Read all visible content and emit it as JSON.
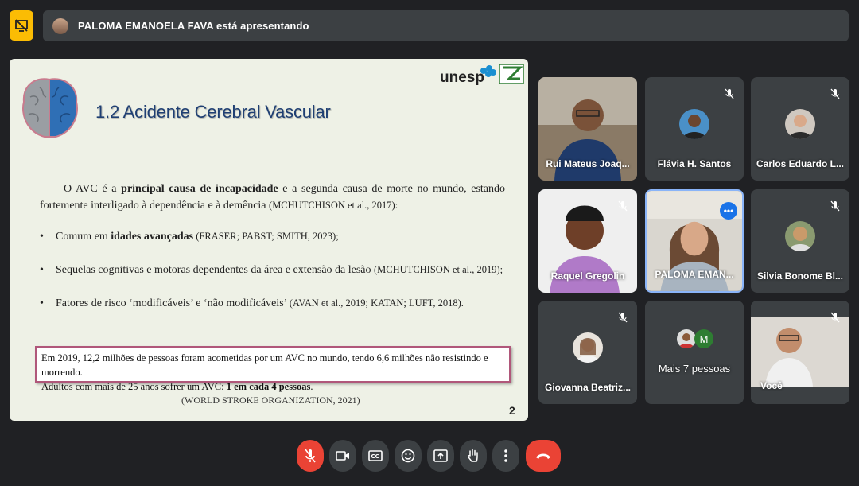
{
  "presenter_bar": {
    "text": "PALOMA EMANOELA FAVA está apresentando"
  },
  "slide": {
    "logo": "unesp",
    "title": "1.2 Acidente Cerebral Vascular",
    "paragraph_intro": "O AVC é a ",
    "paragraph_bold": "principal causa de incapacidade",
    "paragraph_rest": " e a segunda causa de morte no mundo, estando fortemente interligado à dependência e à demência ",
    "paragraph_cite": "(MCHUTCHISON et al., 2017):",
    "bullet1_text": "Comum em ",
    "bullet1_bold": "idades avançadas",
    "bullet1_cite": " (FRASER; PABST; SMITH, 2023);",
    "bullet2_text": "Sequelas cognitivas e motoras dependentes da área e extensão da lesão ",
    "bullet2_cite": "(MCHUTCHISON et al., 2019);",
    "bullet3_text": "Fatores de risco ‘modificáveis’ e ‘não modificáveis’ ",
    "bullet3_cite": "(AVAN et al., 2019; KATAN; LUFT, 2018).",
    "box_line1": "Em 2019, 12,2 milhões de pessoas foram acometidas por um AVC no mundo, tendo 6,6 milhões não resistindo e morrendo.",
    "box_line2_text": "Adultos com mais de 25 anos sofrer um AVC: ",
    "box_line2_bold": "1 em cada 4 pessoas",
    "box_line2_end": ".",
    "source": "(WORLD STROKE ORGANIZATION, 2021)",
    "page_number": "2"
  },
  "participants": [
    {
      "name": "Rui Mateus Joaq..."
    },
    {
      "name": "Flávia H. Santos"
    },
    {
      "name": "Carlos Eduardo L..."
    },
    {
      "name": "Raquel Gregolin"
    },
    {
      "name": "PALOMA EMAN..."
    },
    {
      "name": "Silvia Bonome Bl..."
    },
    {
      "name": "Giovanna Beatriz..."
    },
    {
      "name": "Mais 7 pessoas",
      "badge": "M"
    },
    {
      "name": "Você"
    }
  ],
  "controls": [
    "mic-off",
    "camera",
    "captions",
    "emoji",
    "present",
    "raise-hand",
    "more",
    "end-call"
  ]
}
